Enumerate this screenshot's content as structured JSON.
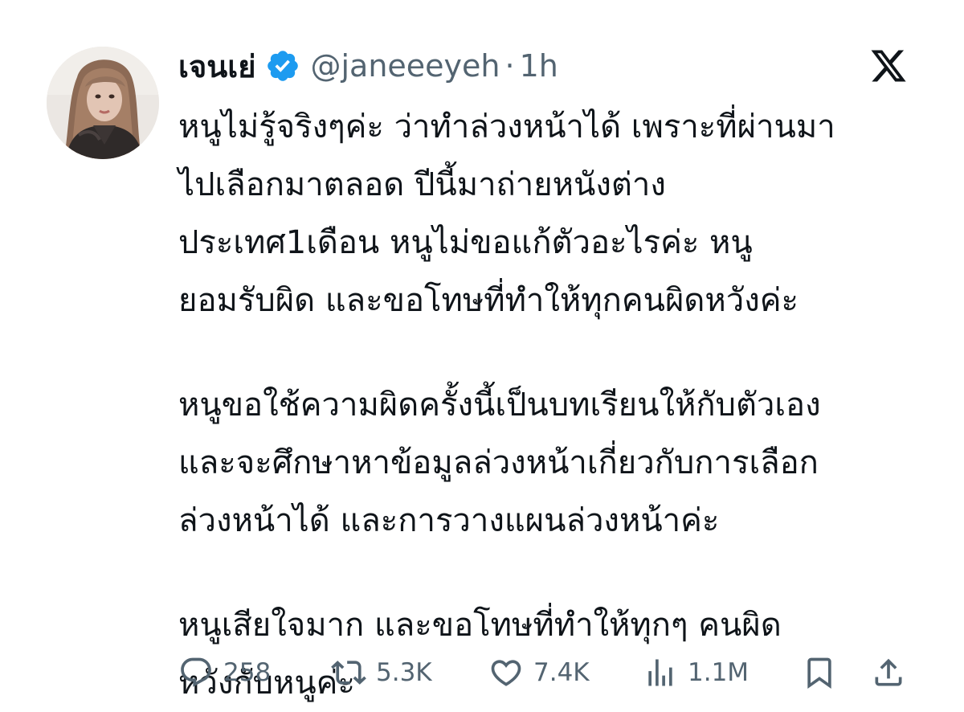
{
  "author": {
    "display_name": "เจนเย่",
    "handle": "@janeeeyeh",
    "separator": "·",
    "time": "1h",
    "verified": true
  },
  "brand": {
    "logo": "x-logo-icon",
    "accent_color": "#1d9bf0"
  },
  "tweet": {
    "paragraphs": [
      [
        "หนูไม่รู้จริงๆค่ะ ว่าทำล่วงหน้าได้ เพราะที่ผ่านมา",
        "ไปเลือกมาตลอด ปีนี้มาถ่ายหนังต่าง",
        "ประเทศ1เดือน หนูไม่ขอแก้ตัวอะไรค่ะ หนู",
        "ยอมรับผิด และขอโทษที่ทำให้ทุกคนผิดหวังค่ะ"
      ],
      [
        "หนูขอใช้ความผิดครั้งนี้เป็นบทเรียนให้กับตัวเอง",
        "และจะศึกษาหาข้อมูลล่วงหน้าเกี่ยวกับการเลือก",
        "ล่วงหน้าได้ และการวางแผนล่วงหน้าค่ะ"
      ],
      [
        "หนูเสียใจมาก และขอโทษที่ทำให้ทุกๆ คนผิด",
        "หวังกับหนูค่ะ"
      ]
    ]
  },
  "actions": {
    "reply": {
      "icon": "reply-icon",
      "count": "258"
    },
    "repost": {
      "icon": "repost-icon",
      "count": "5.3K"
    },
    "like": {
      "icon": "heart-icon",
      "count": "7.4K"
    },
    "views": {
      "icon": "views-icon",
      "count": "1.1M"
    },
    "bookmark": {
      "icon": "bookmark-icon"
    },
    "share": {
      "icon": "share-icon"
    }
  }
}
